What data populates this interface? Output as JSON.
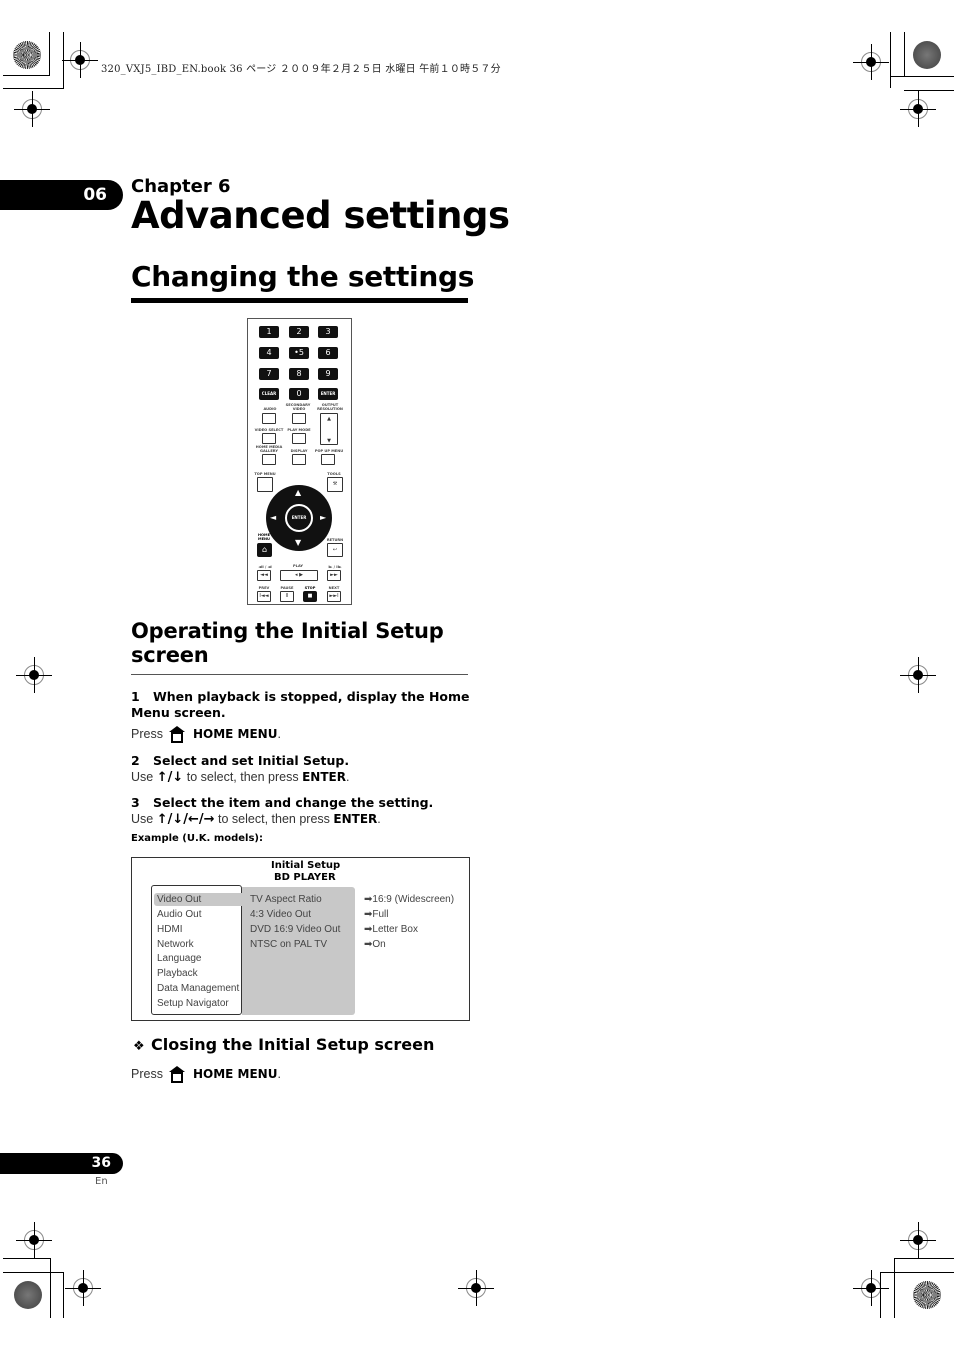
{
  "print_header": "320_VXJ5_IBD_EN.book  36 ページ  ２００９年２月２５日  水曜日  午前１０時５７分",
  "chapter": {
    "tab_number": "06",
    "label": "Chapter 6",
    "title": "Advanced settings"
  },
  "section": {
    "title": "Changing the settings"
  },
  "remote": {
    "number_keys": [
      "1",
      "2",
      "3",
      "4",
      "•5",
      "6",
      "7",
      "8",
      "9"
    ],
    "clear": "CLEAR",
    "zero": "0",
    "enter": "ENTER",
    "labels": {
      "secondary": "SECONDARY",
      "audio": "AUDIO",
      "video": "VIDEO",
      "output_resolution": "OUTPUT RESOLUTION",
      "video_select": "VIDEO SELECT",
      "play_mode": "PLAY MODE",
      "home_media_gallery": "HOME MEDIA GALLERY",
      "display": "DISPLAY",
      "popup_menu": "POP UP MENU",
      "top_menu": "TOP MENU",
      "tools": "TOOLS",
      "dpad_enter": "ENTER",
      "home_menu": "HOME MENU",
      "return": "RETURN",
      "rev_step": "◄II / ◄I",
      "play": "PLAY",
      "fwd_step": "I► / II►",
      "prev": "PREV",
      "pause": "PAUSE",
      "stop": "STOP",
      "next": "NEXT"
    }
  },
  "subsection": {
    "title": "Operating the Initial Setup screen",
    "steps": [
      {
        "number": "1",
        "heading": "When playback is stopped, display the Home Menu screen.",
        "instruction_prefix": "Press",
        "instruction_key": "HOME MENU",
        "instruction_suffix": "."
      },
      {
        "number": "2",
        "heading": "Select and set Initial Setup.",
        "instruction_prefix": "Use",
        "arrows": "🠕/🠗",
        "instruction_middle": "to select, then press",
        "instruction_key": "ENTER",
        "instruction_suffix": "."
      },
      {
        "number": "3",
        "heading": "Select the item and change the setting.",
        "instruction_prefix": "Use",
        "arrows": "🠕/🠗/🠔/🠖",
        "instruction_middle": "to select, then press",
        "instruction_key": "ENTER",
        "instruction_suffix": "."
      }
    ],
    "example_label": "Example (U.K. models):"
  },
  "osd": {
    "title": "Initial Setup",
    "subtitle": "BD PLAYER",
    "menu_items": [
      "Video Out",
      "Audio Out",
      "HDMI",
      "Network",
      "Language",
      "Playback",
      "Data Management",
      "Setup Navigator"
    ],
    "selected_index": 0,
    "settings": [
      "TV Aspect Ratio",
      "4:3 Video Out",
      "DVD 16:9 Video Out",
      "NTSC on PAL TV"
    ],
    "values": [
      "➡16:9 (Widescreen)",
      "➡Full",
      "➡Letter Box",
      "➡On"
    ]
  },
  "closing": {
    "bullet": "❖",
    "title": "Closing the Initial Setup screen",
    "instruction_prefix": "Press",
    "instruction_key": "HOME MENU",
    "instruction_suffix": "."
  },
  "footer": {
    "page_number": "36",
    "language": "En"
  }
}
